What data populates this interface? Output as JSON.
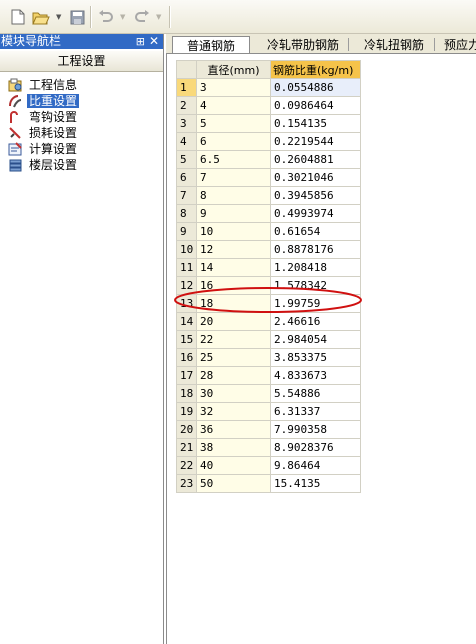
{
  "toolbar": {
    "icons": [
      "new-file-icon",
      "open-folder-icon",
      "save-icon",
      "undo-icon",
      "redo-icon"
    ]
  },
  "nav": {
    "title": "模块导航栏",
    "pin_glyph": "⊞",
    "close_glyph": "✕",
    "section": "工程设置",
    "items": [
      {
        "label": "工程信息",
        "icon": "project-info-icon"
      },
      {
        "label": "比重设置",
        "icon": "weight-setting-icon",
        "selected": true
      },
      {
        "label": "弯钩设置",
        "icon": "hook-setting-icon"
      },
      {
        "label": "损耗设置",
        "icon": "loss-setting-icon"
      },
      {
        "label": "计算设置",
        "icon": "calc-setting-icon"
      },
      {
        "label": "楼层设置",
        "icon": "floor-setting-icon"
      }
    ]
  },
  "tabs": [
    {
      "label": "普通钢筋",
      "active": true
    },
    {
      "label": "冷轧带肋钢筋"
    },
    {
      "label": "冷轧扭钢筋"
    },
    {
      "label": "预应力"
    }
  ],
  "table": {
    "headers": {
      "diameter": "直径(mm)",
      "weight": "钢筋比重(kg/m)"
    },
    "rows": [
      {
        "idx": "1",
        "diameter": "3",
        "weight": "0.0554886"
      },
      {
        "idx": "2",
        "diameter": "4",
        "weight": "0.0986464"
      },
      {
        "idx": "3",
        "diameter": "5",
        "weight": "0.154135"
      },
      {
        "idx": "4",
        "diameter": "6",
        "weight": "0.2219544"
      },
      {
        "idx": "5",
        "diameter": "6.5",
        "weight": "0.2604881"
      },
      {
        "idx": "6",
        "diameter": "7",
        "weight": "0.3021046"
      },
      {
        "idx": "7",
        "diameter": "8",
        "weight": "0.3945856"
      },
      {
        "idx": "8",
        "diameter": "9",
        "weight": "0.4993974"
      },
      {
        "idx": "9",
        "diameter": "10",
        "weight": "0.61654"
      },
      {
        "idx": "10",
        "diameter": "12",
        "weight": "0.8878176"
      },
      {
        "idx": "11",
        "diameter": "14",
        "weight": "1.208418"
      },
      {
        "idx": "12",
        "diameter": "16",
        "weight": "1.578342"
      },
      {
        "idx": "13",
        "diameter": "18",
        "weight": "1.99759"
      },
      {
        "idx": "14",
        "diameter": "20",
        "weight": "2.46616"
      },
      {
        "idx": "15",
        "diameter": "22",
        "weight": "2.984054"
      },
      {
        "idx": "16",
        "diameter": "25",
        "weight": "3.853375"
      },
      {
        "idx": "17",
        "diameter": "28",
        "weight": "4.833673"
      },
      {
        "idx": "18",
        "diameter": "30",
        "weight": "5.54886"
      },
      {
        "idx": "19",
        "diameter": "32",
        "weight": "6.31337"
      },
      {
        "idx": "20",
        "diameter": "36",
        "weight": "7.990358"
      },
      {
        "idx": "21",
        "diameter": "38",
        "weight": "8.9028376"
      },
      {
        "idx": "22",
        "diameter": "40",
        "weight": "9.86464"
      },
      {
        "idx": "23",
        "diameter": "50",
        "weight": "15.4135"
      }
    ],
    "highlighted_row": 12
  },
  "colors": {
    "selection": "#316ac5",
    "header_accent": "#f5c34a",
    "annotation": "#d01010"
  }
}
